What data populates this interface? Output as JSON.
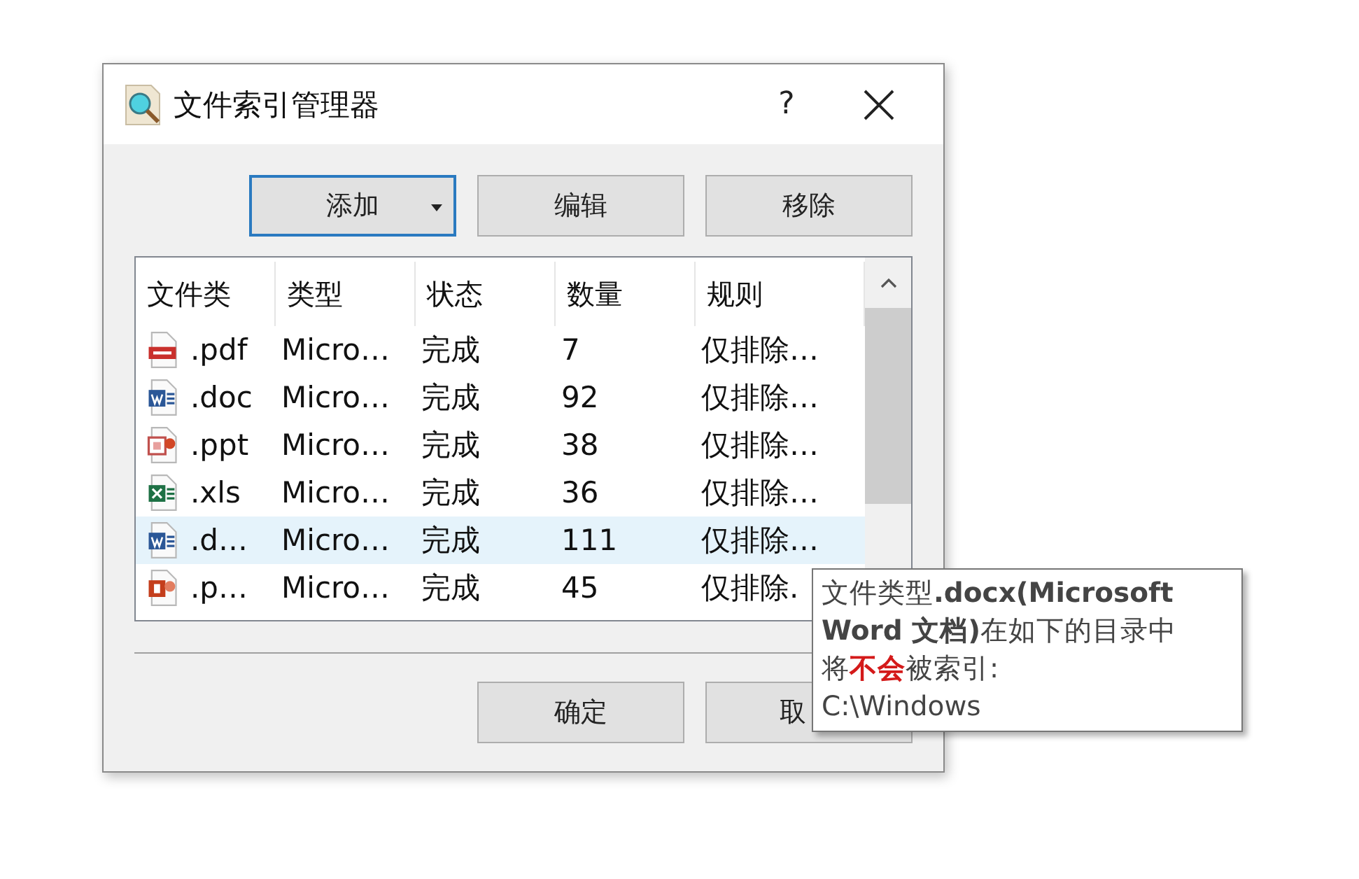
{
  "window": {
    "title": "文件索引管理器",
    "help": "?"
  },
  "toolbar": [
    {
      "label": "添加",
      "focused": true,
      "dropdown": true
    },
    {
      "label": "编辑",
      "focused": false,
      "dropdown": false
    },
    {
      "label": "移除",
      "focused": false,
      "dropdown": false
    }
  ],
  "table": {
    "columns": [
      "文件类",
      "类型",
      "状态",
      "数量",
      "规则"
    ],
    "rows": [
      {
        "kind": "pdf",
        "cells": [
          ".pdf",
          "Micro…",
          "完成",
          "7",
          "仅排除…"
        ],
        "selected": false
      },
      {
        "kind": "word",
        "cells": [
          ".doc",
          "Micro…",
          "完成",
          "92",
          "仅排除…"
        ],
        "selected": false
      },
      {
        "kind": "slides",
        "cells": [
          ".ppt",
          "Micro…",
          "完成",
          "38",
          "仅排除…"
        ],
        "selected": false
      },
      {
        "kind": "excel",
        "cells": [
          ".xls",
          "Micro…",
          "完成",
          "36",
          "仅排除…"
        ],
        "selected": false
      },
      {
        "kind": "word",
        "cells": [
          ".d…",
          "Micro…",
          "完成",
          "111",
          "仅排除…"
        ],
        "selected": true
      },
      {
        "kind": "powerpoint",
        "cells": [
          ".p…",
          "Micro…",
          "完成",
          "45",
          "仅排除."
        ],
        "selected": false
      }
    ]
  },
  "buttons": [
    {
      "label": "确定"
    },
    {
      "label": "取"
    }
  ],
  "tooltip": {
    "lines": [
      [
        {
          "kind": "plain",
          "text": "文件类型"
        },
        {
          "kind": "bold",
          "text": ".docx(Microsoft"
        }
      ],
      [
        {
          "kind": "bold",
          "text": "Word 文档)"
        },
        {
          "kind": "plain",
          "text": "在如下的目录中"
        }
      ],
      [
        {
          "kind": "plain",
          "text": "将"
        },
        {
          "kind": "warning",
          "text": "不会"
        },
        {
          "kind": "plain",
          "text": "被索引:"
        }
      ],
      [
        {
          "kind": "plain",
          "text": "C:\\Windows"
        }
      ]
    ]
  }
}
